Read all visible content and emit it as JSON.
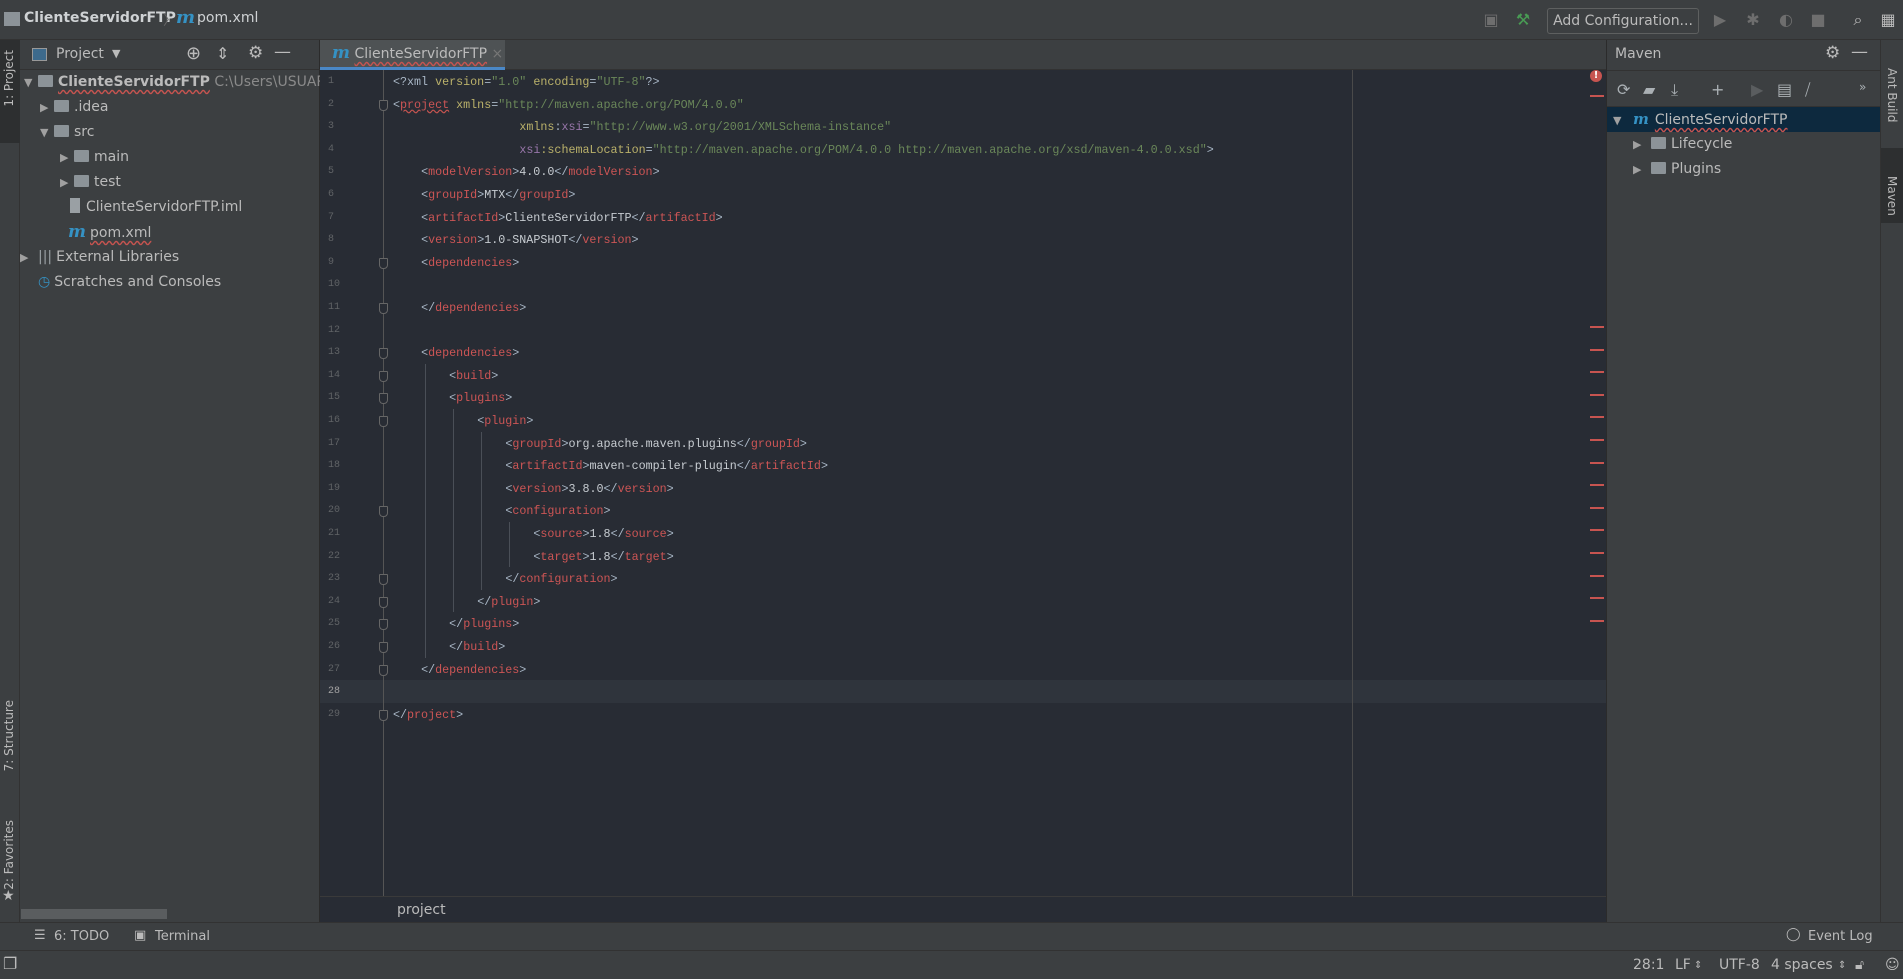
{
  "titlebar": {
    "project": "ClienteServidorFTP",
    "file": "pom.xml",
    "add_config": "Add Configuration..."
  },
  "left_strip": {
    "project_tab": "1: Project",
    "structure_tab": "7: Structure",
    "favorites_tab": "2: Favorites"
  },
  "project_panel": {
    "title": "Project",
    "tree": [
      {
        "label": "ClienteServidorFTP",
        "path": "C:\\Users\\USUARIO",
        "bold": true
      },
      {
        "label": ".idea"
      },
      {
        "label": "src"
      },
      {
        "label": "main"
      },
      {
        "label": "test"
      },
      {
        "label": "ClienteServidorFTP.iml"
      },
      {
        "label": "pom.xml"
      },
      {
        "label": "External Libraries"
      },
      {
        "label": "Scratches and Consoles"
      }
    ]
  },
  "editor": {
    "tab_label": "ClienteServidorFTP",
    "current_line": 28,
    "breadcrumb": "project",
    "lines": [
      {
        "i": 0,
        "t": [
          [
            "br",
            "<?xml "
          ],
          [
            "attr",
            "version"
          ],
          [
            "br",
            "="
          ],
          [
            "val",
            "\"1.0\""
          ],
          [
            "br",
            " "
          ],
          [
            "attr",
            "encoding"
          ],
          [
            "br",
            "="
          ],
          [
            "val",
            "\"UTF-8\""
          ],
          [
            "br",
            "?>"
          ]
        ]
      },
      {
        "i": 0,
        "f": 1,
        "t": [
          [
            "br",
            "<"
          ],
          [
            "tag",
            "project"
          ],
          [
            "br",
            " "
          ],
          [
            "attr",
            "xmlns"
          ],
          [
            "br",
            "="
          ],
          [
            "val",
            "\"http://maven.apache.org/POM/4.0.0\""
          ]
        ]
      },
      {
        "i": 4.5,
        "t": [
          [
            "attr",
            "xmlns"
          ],
          [
            "br",
            ":"
          ],
          [
            "ns",
            "xsi"
          ],
          [
            "br",
            "="
          ],
          [
            "val",
            "\"http://www.w3.org/2001/XMLSchema-instance\""
          ]
        ]
      },
      {
        "i": 4.5,
        "t": [
          [
            "ns",
            "xsi"
          ],
          [
            "attr",
            ":schemaLocation"
          ],
          [
            "br",
            "="
          ],
          [
            "val",
            "\"http://maven.apache.org/POM/4.0.0 http://maven.apache.org/xsd/maven-4.0.0.xsd\""
          ],
          [
            "br",
            ">"
          ]
        ]
      },
      {
        "i": 1,
        "t": [
          [
            "br",
            "<"
          ],
          [
            "tag",
            "modelVersion"
          ],
          [
            "br",
            ">"
          ],
          [
            "txt",
            "4.0.0"
          ],
          [
            "br",
            "</"
          ],
          [
            "tag",
            "modelVersion"
          ],
          [
            "br",
            ">"
          ]
        ]
      },
      {
        "i": 1,
        "t": [
          [
            "br",
            "<"
          ],
          [
            "tag",
            "groupId"
          ],
          [
            "br",
            ">"
          ],
          [
            "txt",
            "MTX"
          ],
          [
            "br",
            "</"
          ],
          [
            "tag",
            "groupId"
          ],
          [
            "br",
            ">"
          ]
        ]
      },
      {
        "i": 1,
        "t": [
          [
            "br",
            "<"
          ],
          [
            "tag",
            "artifactId"
          ],
          [
            "br",
            ">"
          ],
          [
            "txt",
            "ClienteServidorFTP"
          ],
          [
            "br",
            "</"
          ],
          [
            "tag",
            "artifactId"
          ],
          [
            "br",
            ">"
          ]
        ]
      },
      {
        "i": 1,
        "t": [
          [
            "br",
            "<"
          ],
          [
            "tag",
            "version"
          ],
          [
            "br",
            ">"
          ],
          [
            "txt",
            "1.0-SNAPSHOT"
          ],
          [
            "br",
            "</"
          ],
          [
            "tag",
            "version"
          ],
          [
            "br",
            ">"
          ]
        ]
      },
      {
        "i": 1,
        "f": 1,
        "t": [
          [
            "br",
            "<"
          ],
          [
            "tag",
            "dependencies"
          ],
          [
            "br",
            ">"
          ]
        ]
      },
      {
        "i": 0,
        "t": []
      },
      {
        "i": 1,
        "f": 1,
        "t": [
          [
            "br",
            "</"
          ],
          [
            "tag",
            "dependencies"
          ],
          [
            "br",
            ">"
          ]
        ]
      },
      {
        "i": 0,
        "t": []
      },
      {
        "i": 1,
        "f": 1,
        "t": [
          [
            "br",
            "<"
          ],
          [
            "tag",
            "dependencies"
          ],
          [
            "br",
            ">"
          ]
        ]
      },
      {
        "i": 2,
        "f": 1,
        "t": [
          [
            "br",
            "<"
          ],
          [
            "tag",
            "build"
          ],
          [
            "br",
            ">"
          ]
        ]
      },
      {
        "i": 2,
        "f": 1,
        "t": [
          [
            "br",
            "<"
          ],
          [
            "tag",
            "plugins"
          ],
          [
            "br",
            ">"
          ]
        ]
      },
      {
        "i": 3,
        "f": 1,
        "t": [
          [
            "br",
            "<"
          ],
          [
            "tag",
            "plugin"
          ],
          [
            "br",
            ">"
          ]
        ]
      },
      {
        "i": 4,
        "t": [
          [
            "br",
            "<"
          ],
          [
            "tag",
            "groupId"
          ],
          [
            "br",
            ">"
          ],
          [
            "txt",
            "org.apache.maven.plugins"
          ],
          [
            "br",
            "</"
          ],
          [
            "tag",
            "groupId"
          ],
          [
            "br",
            ">"
          ]
        ]
      },
      {
        "i": 4,
        "t": [
          [
            "br",
            "<"
          ],
          [
            "tag",
            "artifactId"
          ],
          [
            "br",
            ">"
          ],
          [
            "txt",
            "maven-compiler-plugin"
          ],
          [
            "br",
            "</"
          ],
          [
            "tag",
            "artifactId"
          ],
          [
            "br",
            ">"
          ]
        ]
      },
      {
        "i": 4,
        "t": [
          [
            "br",
            "<"
          ],
          [
            "tag",
            "version"
          ],
          [
            "br",
            ">"
          ],
          [
            "txt",
            "3.8.0"
          ],
          [
            "br",
            "</"
          ],
          [
            "tag",
            "version"
          ],
          [
            "br",
            ">"
          ]
        ]
      },
      {
        "i": 4,
        "f": 1,
        "t": [
          [
            "br",
            "<"
          ],
          [
            "tag",
            "configuration"
          ],
          [
            "br",
            ">"
          ]
        ]
      },
      {
        "i": 5,
        "t": [
          [
            "br",
            "<"
          ],
          [
            "tag",
            "source"
          ],
          [
            "br",
            ">"
          ],
          [
            "txt",
            "1.8"
          ],
          [
            "br",
            "</"
          ],
          [
            "tag",
            "source"
          ],
          [
            "br",
            ">"
          ]
        ]
      },
      {
        "i": 5,
        "t": [
          [
            "br",
            "<"
          ],
          [
            "tag",
            "target"
          ],
          [
            "br",
            ">"
          ],
          [
            "txt",
            "1.8"
          ],
          [
            "br",
            "</"
          ],
          [
            "tag",
            "target"
          ],
          [
            "br",
            ">"
          ]
        ]
      },
      {
        "i": 4,
        "f": 1,
        "t": [
          [
            "br",
            "</"
          ],
          [
            "tag",
            "configuration"
          ],
          [
            "br",
            ">"
          ]
        ]
      },
      {
        "i": 3,
        "f": 1,
        "t": [
          [
            "br",
            "</"
          ],
          [
            "tag",
            "plugin"
          ],
          [
            "br",
            ">"
          ]
        ]
      },
      {
        "i": 2,
        "f": 1,
        "t": [
          [
            "br",
            "</"
          ],
          [
            "tag",
            "plugins"
          ],
          [
            "br",
            ">"
          ]
        ]
      },
      {
        "i": 2,
        "f": 1,
        "t": [
          [
            "br",
            "</"
          ],
          [
            "tag",
            "build"
          ],
          [
            "br",
            ">"
          ]
        ]
      },
      {
        "i": 1,
        "f": 1,
        "t": [
          [
            "br",
            "</"
          ],
          [
            "tag",
            "dependencies"
          ],
          [
            "br",
            ">"
          ]
        ]
      },
      {
        "i": 0,
        "t": []
      },
      {
        "i": 0,
        "f": 1,
        "t": [
          [
            "br",
            "</"
          ],
          [
            "tag",
            "project"
          ],
          [
            "br",
            ">"
          ]
        ]
      }
    ]
  },
  "maven": {
    "title": "Maven",
    "tree": [
      {
        "label": "ClienteServidorFTP",
        "selected": true
      },
      {
        "label": "Lifecycle"
      },
      {
        "label": "Plugins"
      }
    ]
  },
  "right_strip": {
    "ant": "Ant Build",
    "maven": "Maven"
  },
  "bottom_tools": {
    "todo": "6: TODO",
    "terminal": "Terminal",
    "event_log": "Event Log"
  },
  "status": {
    "position": "28:1",
    "line_sep": "LF",
    "encoding": "UTF-8",
    "indent": "4 spaces"
  },
  "colors": {
    "accent": "#4a88c7",
    "selection": "#0d293e",
    "error": "#c75450"
  }
}
